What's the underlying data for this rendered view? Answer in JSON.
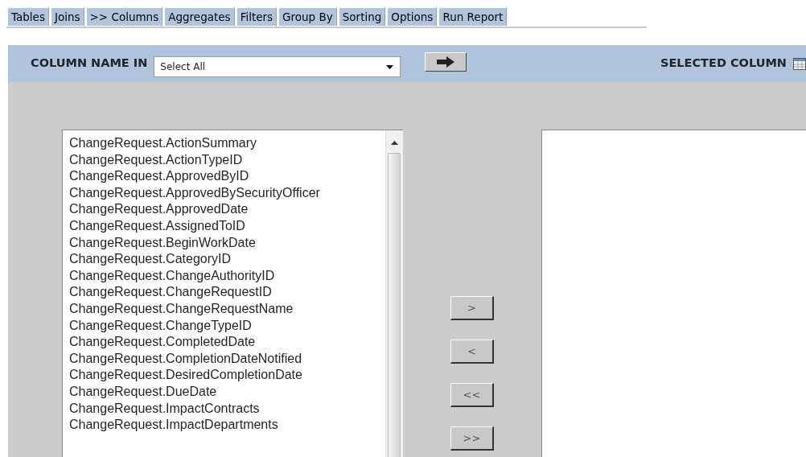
{
  "tabs": [
    {
      "label": "Tables"
    },
    {
      "label": "Joins"
    },
    {
      "label": ">> Columns"
    },
    {
      "label": "Aggregates"
    },
    {
      "label": "Filters"
    },
    {
      "label": "Group By"
    },
    {
      "label": "Sorting"
    },
    {
      "label": "Options"
    },
    {
      "label": "Run Report"
    }
  ],
  "header": {
    "column_name_label": "COLUMN NAME IN",
    "table_select": {
      "value": "Select All"
    },
    "selected_column_label": "SELECTED COLUMN"
  },
  "available_columns": [
    "ChangeRequest.ActionSummary",
    "ChangeRequest.ActionTypeID",
    "ChangeRequest.ApprovedByID",
    "ChangeRequest.ApprovedBySecurityOfficer",
    "ChangeRequest.ApprovedDate",
    "ChangeRequest.AssignedToID",
    "ChangeRequest.BeginWorkDate",
    "ChangeRequest.CategoryID",
    "ChangeRequest.ChangeAuthorityID",
    "ChangeRequest.ChangeRequestID",
    "ChangeRequest.ChangeRequestName",
    "ChangeRequest.ChangeTypeID",
    "ChangeRequest.CompletedDate",
    "ChangeRequest.CompletionDateNotified",
    "ChangeRequest.DesiredCompletionDate",
    "ChangeRequest.DueDate",
    "ChangeRequest.ImpactContracts",
    "ChangeRequest.ImpactDepartments"
  ],
  "move_buttons": [
    {
      "label": ">"
    },
    {
      "label": "<"
    },
    {
      "label": "<<"
    },
    {
      "label": ">>"
    }
  ]
}
